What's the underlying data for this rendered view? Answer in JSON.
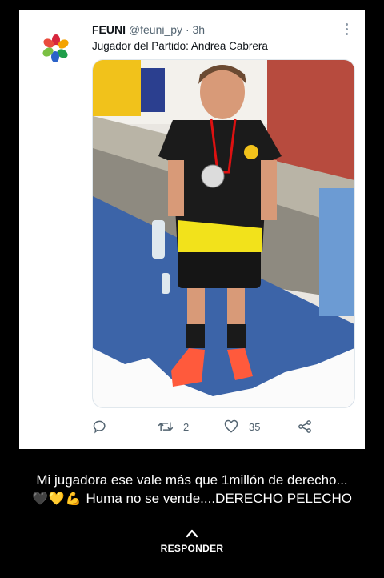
{
  "tweet": {
    "name": "FEUNI",
    "handle": "@feuni_py",
    "dot": "·",
    "time": "3h",
    "text": "Jugador del Partido: Andrea Cabrera",
    "image_alt": "Jugadora con medalla",
    "actions": {
      "reply_icon": "reply-icon",
      "retweet_icon": "retweet-icon",
      "retweet_count": "2",
      "like_icon": "heart-icon",
      "like_count": "35",
      "share_icon": "share-icon"
    }
  },
  "comment": {
    "line1": "Mi jugadora ese vale más que 1millón de derecho...",
    "emojis": "🖤💛💪",
    "line2": "Huma no se vende....DERECHO PELECHO"
  },
  "footer": {
    "respond_label": "RESPONDER"
  },
  "colors": {
    "background": "#000000",
    "card": "#ffffff",
    "muted": "#536471"
  }
}
